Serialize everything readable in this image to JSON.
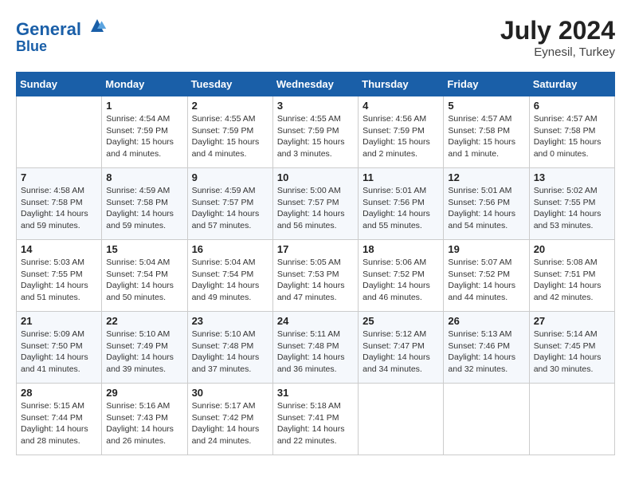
{
  "header": {
    "logo_line1": "General",
    "logo_line2": "Blue",
    "month_year": "July 2024",
    "location": "Eynesil, Turkey"
  },
  "days_of_week": [
    "Sunday",
    "Monday",
    "Tuesday",
    "Wednesday",
    "Thursday",
    "Friday",
    "Saturday"
  ],
  "weeks": [
    [
      {
        "day": "",
        "info": ""
      },
      {
        "day": "1",
        "info": "Sunrise: 4:54 AM\nSunset: 7:59 PM\nDaylight: 15 hours\nand 4 minutes."
      },
      {
        "day": "2",
        "info": "Sunrise: 4:55 AM\nSunset: 7:59 PM\nDaylight: 15 hours\nand 4 minutes."
      },
      {
        "day": "3",
        "info": "Sunrise: 4:55 AM\nSunset: 7:59 PM\nDaylight: 15 hours\nand 3 minutes."
      },
      {
        "day": "4",
        "info": "Sunrise: 4:56 AM\nSunset: 7:59 PM\nDaylight: 15 hours\nand 2 minutes."
      },
      {
        "day": "5",
        "info": "Sunrise: 4:57 AM\nSunset: 7:58 PM\nDaylight: 15 hours\nand 1 minute."
      },
      {
        "day": "6",
        "info": "Sunrise: 4:57 AM\nSunset: 7:58 PM\nDaylight: 15 hours\nand 0 minutes."
      }
    ],
    [
      {
        "day": "7",
        "info": "Sunrise: 4:58 AM\nSunset: 7:58 PM\nDaylight: 14 hours\nand 59 minutes."
      },
      {
        "day": "8",
        "info": "Sunrise: 4:59 AM\nSunset: 7:58 PM\nDaylight: 14 hours\nand 59 minutes."
      },
      {
        "day": "9",
        "info": "Sunrise: 4:59 AM\nSunset: 7:57 PM\nDaylight: 14 hours\nand 57 minutes."
      },
      {
        "day": "10",
        "info": "Sunrise: 5:00 AM\nSunset: 7:57 PM\nDaylight: 14 hours\nand 56 minutes."
      },
      {
        "day": "11",
        "info": "Sunrise: 5:01 AM\nSunset: 7:56 PM\nDaylight: 14 hours\nand 55 minutes."
      },
      {
        "day": "12",
        "info": "Sunrise: 5:01 AM\nSunset: 7:56 PM\nDaylight: 14 hours\nand 54 minutes."
      },
      {
        "day": "13",
        "info": "Sunrise: 5:02 AM\nSunset: 7:55 PM\nDaylight: 14 hours\nand 53 minutes."
      }
    ],
    [
      {
        "day": "14",
        "info": "Sunrise: 5:03 AM\nSunset: 7:55 PM\nDaylight: 14 hours\nand 51 minutes."
      },
      {
        "day": "15",
        "info": "Sunrise: 5:04 AM\nSunset: 7:54 PM\nDaylight: 14 hours\nand 50 minutes."
      },
      {
        "day": "16",
        "info": "Sunrise: 5:04 AM\nSunset: 7:54 PM\nDaylight: 14 hours\nand 49 minutes."
      },
      {
        "day": "17",
        "info": "Sunrise: 5:05 AM\nSunset: 7:53 PM\nDaylight: 14 hours\nand 47 minutes."
      },
      {
        "day": "18",
        "info": "Sunrise: 5:06 AM\nSunset: 7:52 PM\nDaylight: 14 hours\nand 46 minutes."
      },
      {
        "day": "19",
        "info": "Sunrise: 5:07 AM\nSunset: 7:52 PM\nDaylight: 14 hours\nand 44 minutes."
      },
      {
        "day": "20",
        "info": "Sunrise: 5:08 AM\nSunset: 7:51 PM\nDaylight: 14 hours\nand 42 minutes."
      }
    ],
    [
      {
        "day": "21",
        "info": "Sunrise: 5:09 AM\nSunset: 7:50 PM\nDaylight: 14 hours\nand 41 minutes."
      },
      {
        "day": "22",
        "info": "Sunrise: 5:10 AM\nSunset: 7:49 PM\nDaylight: 14 hours\nand 39 minutes."
      },
      {
        "day": "23",
        "info": "Sunrise: 5:10 AM\nSunset: 7:48 PM\nDaylight: 14 hours\nand 37 minutes."
      },
      {
        "day": "24",
        "info": "Sunrise: 5:11 AM\nSunset: 7:48 PM\nDaylight: 14 hours\nand 36 minutes."
      },
      {
        "day": "25",
        "info": "Sunrise: 5:12 AM\nSunset: 7:47 PM\nDaylight: 14 hours\nand 34 minutes."
      },
      {
        "day": "26",
        "info": "Sunrise: 5:13 AM\nSunset: 7:46 PM\nDaylight: 14 hours\nand 32 minutes."
      },
      {
        "day": "27",
        "info": "Sunrise: 5:14 AM\nSunset: 7:45 PM\nDaylight: 14 hours\nand 30 minutes."
      }
    ],
    [
      {
        "day": "28",
        "info": "Sunrise: 5:15 AM\nSunset: 7:44 PM\nDaylight: 14 hours\nand 28 minutes."
      },
      {
        "day": "29",
        "info": "Sunrise: 5:16 AM\nSunset: 7:43 PM\nDaylight: 14 hours\nand 26 minutes."
      },
      {
        "day": "30",
        "info": "Sunrise: 5:17 AM\nSunset: 7:42 PM\nDaylight: 14 hours\nand 24 minutes."
      },
      {
        "day": "31",
        "info": "Sunrise: 5:18 AM\nSunset: 7:41 PM\nDaylight: 14 hours\nand 22 minutes."
      },
      {
        "day": "",
        "info": ""
      },
      {
        "day": "",
        "info": ""
      },
      {
        "day": "",
        "info": ""
      }
    ]
  ]
}
